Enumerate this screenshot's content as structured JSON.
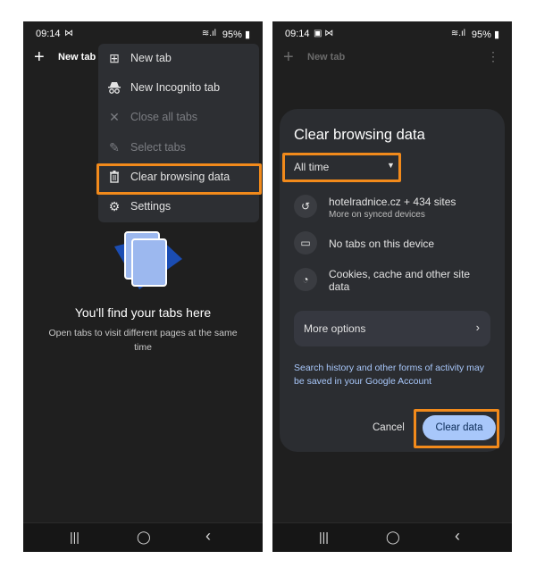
{
  "left": {
    "status": {
      "time": "09:14",
      "notif_icon": "mail-icon",
      "battery": "95%"
    },
    "toolbar": {
      "plus": "+",
      "new_tab_label": "New tab"
    },
    "menu": [
      {
        "label": "New tab",
        "icon": "new-tab-icon",
        "glyph": "⊞",
        "disabled": false
      },
      {
        "label": "New Incognito tab",
        "icon": "incognito-icon",
        "glyph": "👓",
        "disabled": false
      },
      {
        "label": "Close all tabs",
        "icon": "close-icon",
        "glyph": "✕",
        "disabled": true
      },
      {
        "label": "Select tabs",
        "icon": "pencil-icon",
        "glyph": "✎",
        "disabled": true
      },
      {
        "label": "Clear browsing data",
        "icon": "trash-icon",
        "glyph": "🗑",
        "disabled": false,
        "highlighted": true
      },
      {
        "label": "Settings",
        "icon": "gear-icon",
        "glyph": "⚙",
        "disabled": false
      }
    ],
    "empty": {
      "title": "You'll find your tabs here",
      "subtitle": "Open tabs to visit different pages at the same time"
    }
  },
  "right": {
    "status": {
      "time": "09:14",
      "battery": "95%"
    },
    "toolbar": {
      "plus": "+",
      "new_tab_label": "New tab",
      "more": "⋮"
    },
    "dialog": {
      "title": "Clear browsing data",
      "time_range": "All time",
      "history": {
        "title": "hotelradnice.cz + 434 sites",
        "subtitle": "More on synced devices"
      },
      "tabs": {
        "title": "No tabs on this device"
      },
      "cookies": {
        "title": "Cookies, cache and other site data"
      },
      "more_options": "More options",
      "note": "Search history and other forms of activity may be saved in your Google Account",
      "cancel": "Cancel",
      "clear": "Clear data"
    }
  },
  "nav": {
    "recents": "|||",
    "home": "◯",
    "back": "‹"
  },
  "colors": {
    "highlight": "#f28a1b",
    "accent": "#a8c7fa",
    "background": "#1f1f1f",
    "surface": "#2b2d31"
  }
}
